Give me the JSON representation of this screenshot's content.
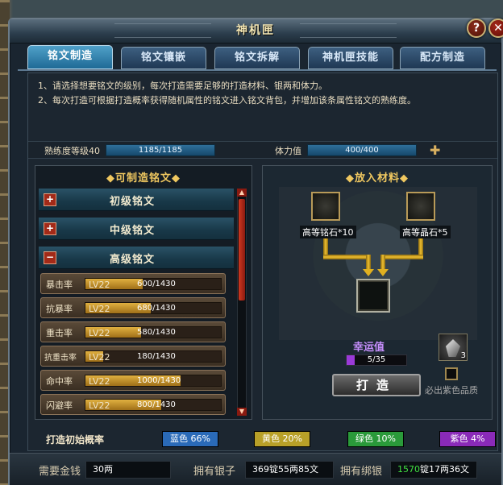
{
  "window": {
    "title": "神机匣"
  },
  "tabs": [
    "铭文制造",
    "铭文镶嵌",
    "铭文拆解",
    "神机匣技能",
    "配方制造"
  ],
  "notes": [
    "1、请选择想要铭文的级别，每次打造需要足够的打造材料、银两和体力。",
    "2、每次打造可根据打造概率获得随机属性的铭文进入铭文背包，并增加该条属性铭文的熟练度。"
  ],
  "stats": {
    "proficiency_label": "熟练度等级40",
    "proficiency_value": "1185/1185",
    "stamina_label": "体力值",
    "stamina_value": "400/400"
  },
  "left_panel": {
    "title": "◆可制造铭文◆",
    "categories": [
      {
        "label": "初级铭文",
        "toggle": "+"
      },
      {
        "label": "中级铭文",
        "toggle": "+"
      },
      {
        "label": "高级铭文",
        "toggle": "−"
      }
    ],
    "runes": [
      {
        "name": "暴击率",
        "level": "LV22",
        "progress": "600/1430",
        "fraction": 0.42
      },
      {
        "name": "抗暴率",
        "level": "LV22",
        "progress": "680/1430",
        "fraction": 0.48
      },
      {
        "name": "重击率",
        "level": "LV22",
        "progress": "580/1430",
        "fraction": 0.41
      },
      {
        "name": "抗重击率",
        "level": "LV22",
        "progress": "180/1430",
        "fraction": 0.13
      },
      {
        "name": "命中率",
        "level": "LV22",
        "progress": "1000/1430",
        "fraction": 0.7
      },
      {
        "name": "闪避率",
        "level": "LV22",
        "progress": "800/1430",
        "fraction": 0.56
      }
    ]
  },
  "right_panel": {
    "title": "◆放入材料◆",
    "material_1": "高等铭石*10",
    "material_2": "高等晶石*5",
    "luck_label": "幸运值",
    "luck_value": "5/35",
    "luck_fraction": 0.14,
    "forge_button": "打造",
    "crystal_count": "3",
    "must_purple_label": "必出紫色品质"
  },
  "probability": {
    "label": "打造初始概率",
    "chips": [
      {
        "text": "蓝色 66%",
        "color": "#2a6ab8"
      },
      {
        "text": "黄色 20%",
        "color": "#b8a028"
      },
      {
        "text": "绿色 10%",
        "color": "#2a9a3a"
      },
      {
        "text": "紫色 4%",
        "color": "#8a2ab8"
      }
    ]
  },
  "bottom": {
    "gold_label": "需要金钱",
    "gold_value": "30两",
    "silver_label": "拥有银子",
    "silver_value": "369锭55两85文",
    "bound_label": "拥有绑银",
    "bound_value_green": "1570",
    "bound_value_rest": "锭17两36文"
  }
}
